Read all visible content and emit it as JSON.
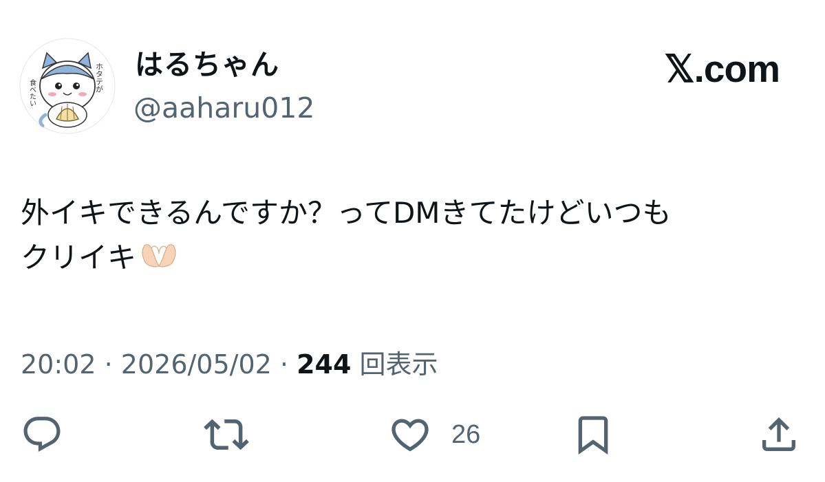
{
  "user": {
    "display_name": "はるちゃん",
    "handle": "@aaharu012",
    "avatar_text_top": "ホタテが",
    "avatar_text_side": "食べたい"
  },
  "brand": "𝕏.com",
  "tweet": {
    "line1": "外イキできるんですか？ってDMきてたけどいつも",
    "line2": "クリイキ",
    "emoji": "heart-hands"
  },
  "meta": {
    "time": "20:02",
    "separator": "·",
    "date": "2026/05/02",
    "views_count": "244",
    "views_label": "回表示"
  },
  "actions": {
    "reply_count": "",
    "repost_count": "",
    "like_count": "26",
    "bookmark_count": ""
  },
  "colors": {
    "text_primary": "#0f1419",
    "text_secondary": "#536471",
    "background": "#ffffff"
  }
}
